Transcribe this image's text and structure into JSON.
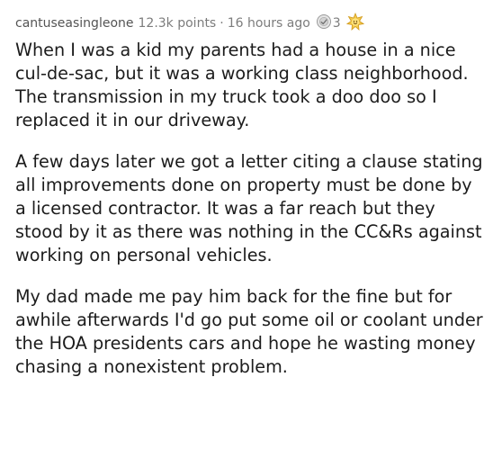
{
  "comment": {
    "author": "cantuseasingleone",
    "points": "12.3k points",
    "separator": "·",
    "time": "16 hours ago",
    "awards": [
      {
        "icon": "silver-award-icon",
        "count": "3"
      },
      {
        "icon": "wholesome-award-icon",
        "count": ""
      }
    ],
    "paragraphs": [
      "When I was a kid my parents had a house in a nice cul-de-sac, but it was a working class neighborhood. The transmission in my truck took a doo doo so I replaced it in our driveway.",
      "A few days later we got a letter citing a clause stating all improvements done on property must be done by a licensed contractor. It was a far reach but they stood by it as there was nothing in the CC&Rs against working on personal vehicles.",
      "My dad made me pay him back for the fine but for awhile afterwards I'd go put some oil or coolant under the HOA presidents cars and hope he wasting money chasing a nonexistent problem."
    ]
  }
}
